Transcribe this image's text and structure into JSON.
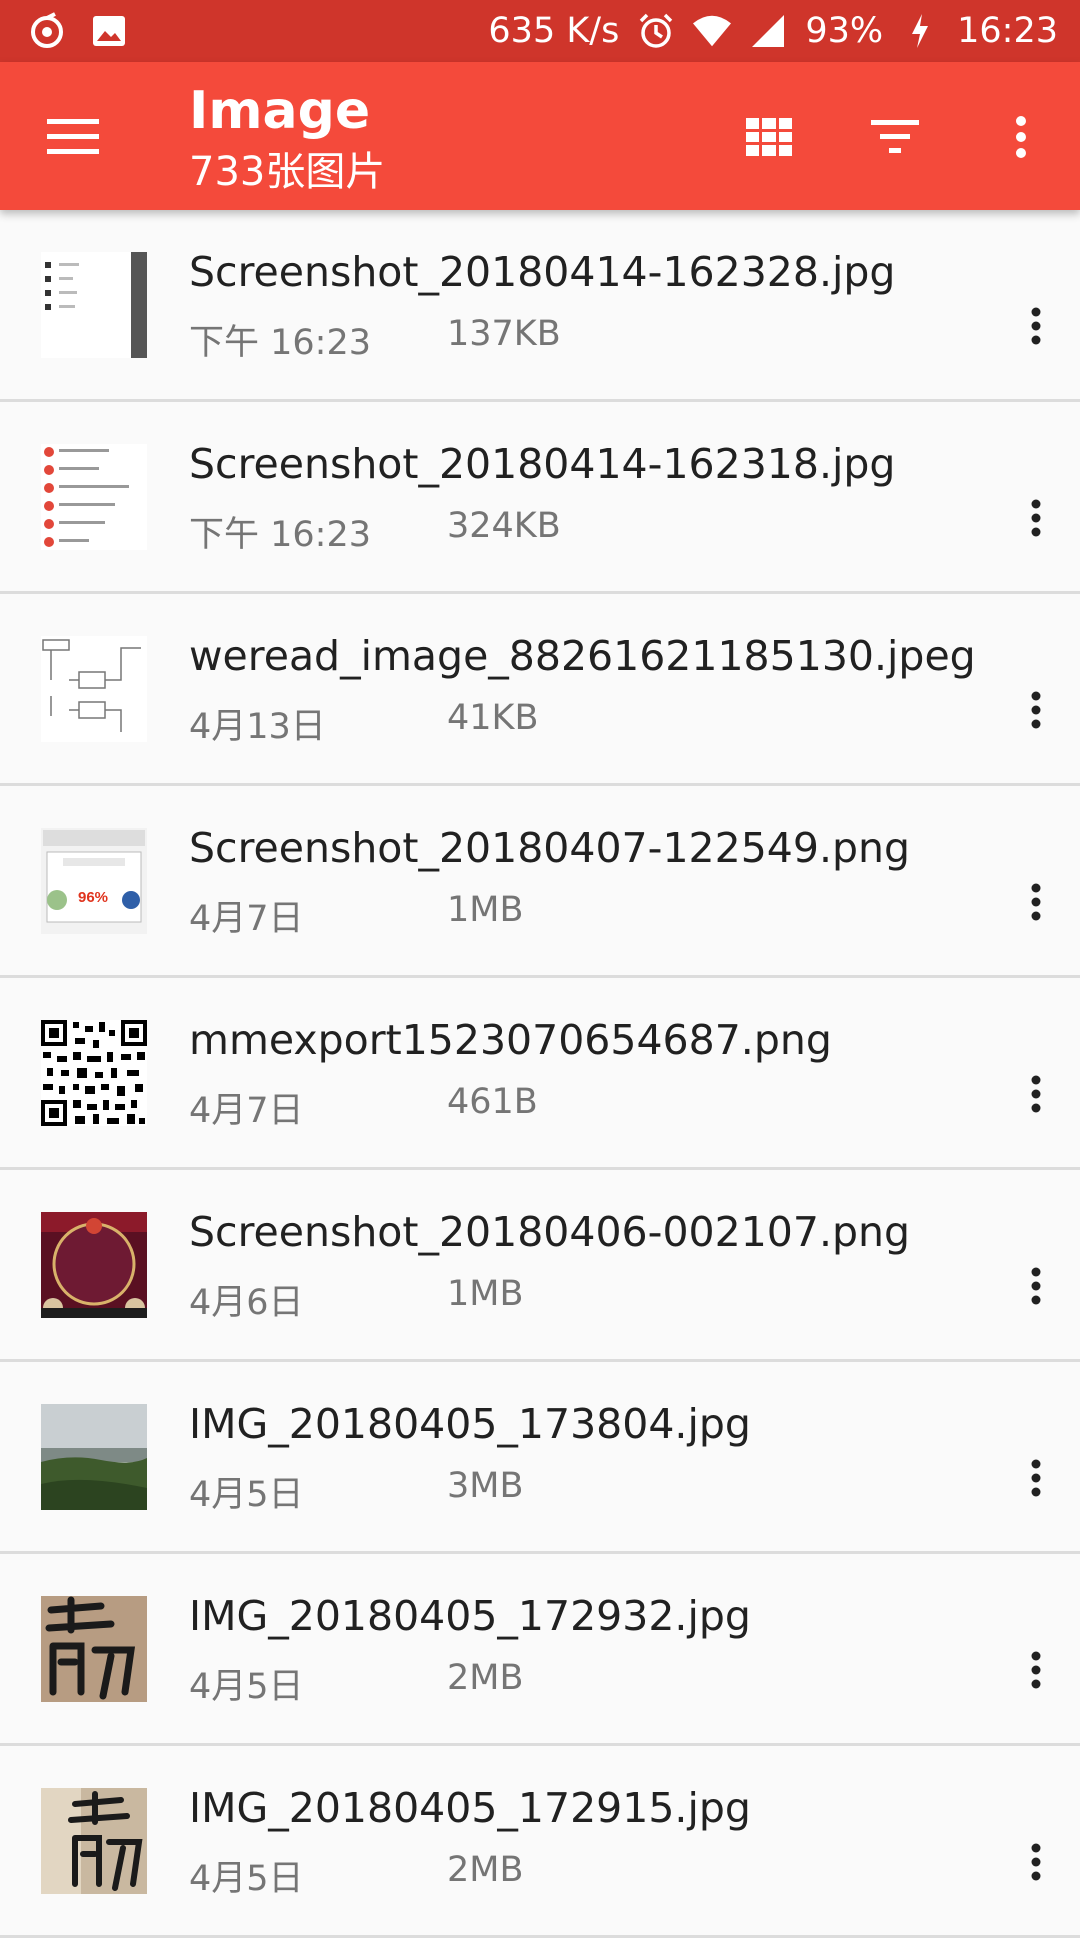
{
  "status_bar": {
    "speed": "635 K/s",
    "battery": "93%",
    "time": "16:23",
    "icons": [
      "app-notification-icon",
      "image-notification-icon",
      "alarm-icon",
      "wifi-icon",
      "signal-icon",
      "charging-icon"
    ]
  },
  "app_bar": {
    "title": "Image",
    "subtitle": "733张图片",
    "icons": [
      "menu-icon",
      "grid-view-icon",
      "filter-icon",
      "more-vert-icon"
    ]
  },
  "colors": {
    "app_bar": "#f44a3b",
    "status_bar": "#cf352b",
    "background": "#fafafa"
  },
  "files": [
    {
      "name": "Screenshot_20180414-162328.jpg",
      "date": "下午 16:23",
      "size": "137KB"
    },
    {
      "name": "Screenshot_20180414-162318.jpg",
      "date": "下午 16:23",
      "size": "324KB"
    },
    {
      "name": "weread_image_88261621185130.jpeg",
      "date": "4月13日",
      "size": "41KB"
    },
    {
      "name": "Screenshot_20180407-122549.png",
      "date": "4月7日",
      "size": "1MB",
      "thumb_text": "96%"
    },
    {
      "name": "mmexport1523070654687.png",
      "date": "4月7日",
      "size": "461B"
    },
    {
      "name": "Screenshot_20180406-002107.png",
      "date": "4月6日",
      "size": "1MB"
    },
    {
      "name": "IMG_20180405_173804.jpg",
      "date": "4月5日",
      "size": "3MB"
    },
    {
      "name": "IMG_20180405_172932.jpg",
      "date": "4月5日",
      "size": "2MB"
    },
    {
      "name": "IMG_20180405_172915.jpg",
      "date": "4月5日",
      "size": "2MB"
    }
  ]
}
